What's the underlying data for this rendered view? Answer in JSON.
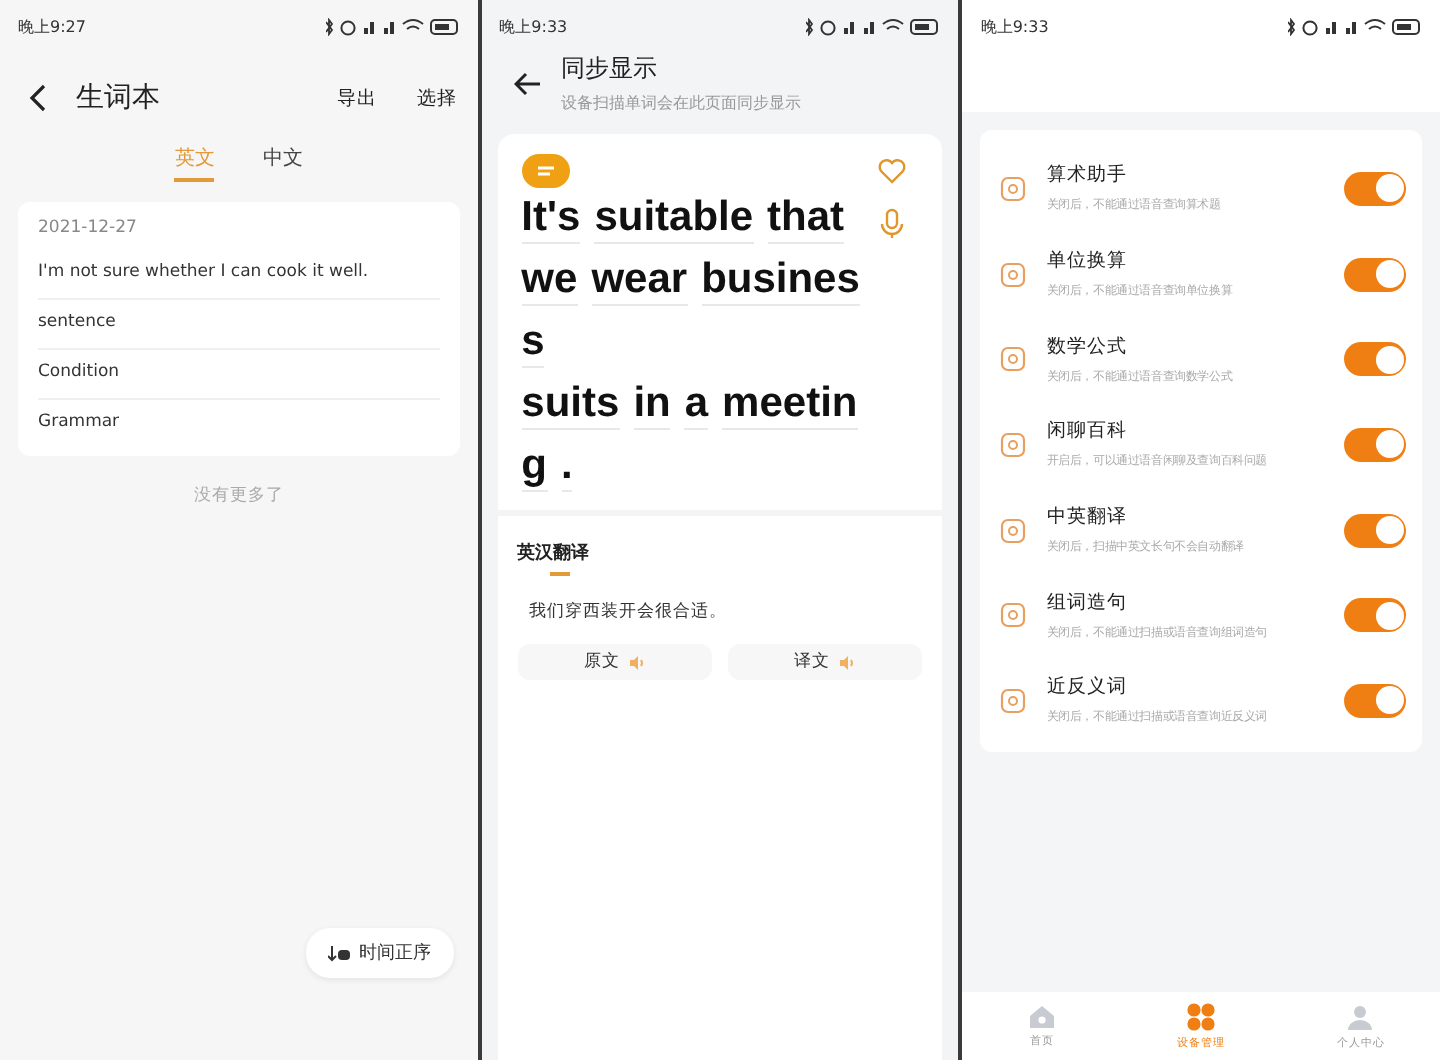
{
  "screens": [
    {
      "status_time": "晚上9:27",
      "title": "生词本",
      "actions": [
        "导出",
        "选择"
      ],
      "tabs": [
        {
          "label": "英文",
          "selected": true
        },
        {
          "label": "中文",
          "selected": false
        }
      ],
      "card": {
        "date": "2021-12-27",
        "sentence": "I'm not sure whether I can cook it well.",
        "items": [
          "sentence",
          "Condition",
          "Grammar"
        ]
      },
      "footer": "没有更多了",
      "sort_button": "时间正序"
    },
    {
      "status_time": "晚上9:33",
      "title": "同步显示",
      "subtitle": "设备扫描单词会在此页面同步显示",
      "lines": [
        [
          "It's",
          "suitable",
          "that"
        ],
        [
          "we",
          "wear",
          "busines"
        ],
        [
          "s"
        ],
        [
          "suits",
          "in",
          "a",
          "meetin"
        ],
        [
          "g",
          "."
        ]
      ],
      "translation": {
        "tab": "英汉翻译",
        "text": "我们穿西装开会很合适。",
        "buttons": [
          "原文",
          "译文"
        ]
      }
    },
    {
      "status_time": "晚上9:33",
      "settings": [
        {
          "title": "算术助手",
          "desc": "关闭后，不能通过语音查询算术题",
          "on": true
        },
        {
          "title": "单位换算",
          "desc": "关闭后，不能通过语音查询单位换算",
          "on": true
        },
        {
          "title": "数学公式",
          "desc": "关闭后，不能通过语音查询数学公式",
          "on": true
        },
        {
          "title": "闲聊百科",
          "desc": "开启后，可以通过语音闲聊及查询百科问题",
          "on": true
        },
        {
          "title": "中英翻译",
          "desc": "关闭后，扫描中英文长句不会自动翻译",
          "on": true
        },
        {
          "title": "组词造句",
          "desc": "关闭后，不能通过扫描或语音查询组词造句",
          "on": true
        },
        {
          "title": "近反义词",
          "desc": "关闭后，不能通过扫描或语音查询近反义词",
          "on": true
        }
      ],
      "nav": [
        {
          "label": "首页",
          "selected": false
        },
        {
          "label": "设备管理",
          "selected": true
        },
        {
          "label": "个人中心",
          "selected": false
        }
      ]
    }
  ]
}
